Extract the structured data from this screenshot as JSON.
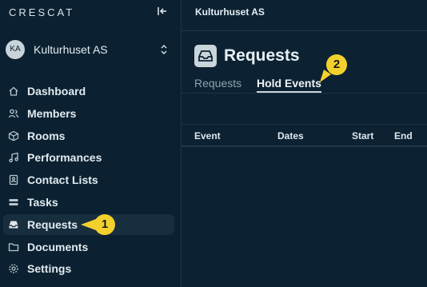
{
  "sidebar": {
    "logo": "CRESCAT",
    "org": {
      "initials": "KA",
      "name": "Kulturhuset AS"
    },
    "items": [
      {
        "label": "Dashboard",
        "icon": "home-icon"
      },
      {
        "label": "Members",
        "icon": "users-icon"
      },
      {
        "label": "Rooms",
        "icon": "cube-icon"
      },
      {
        "label": "Performances",
        "icon": "music-icon"
      },
      {
        "label": "Contact Lists",
        "icon": "contact-card-icon"
      },
      {
        "label": "Tasks",
        "icon": "tasks-icon"
      },
      {
        "label": "Requests",
        "icon": "inbox-icon",
        "active": true
      },
      {
        "label": "Documents",
        "icon": "folder-icon"
      },
      {
        "label": "Settings",
        "icon": "gear-icon"
      }
    ]
  },
  "topbar": {
    "title": "Kulturhuset AS"
  },
  "page": {
    "title": "Requests",
    "tabs": [
      {
        "label": "Requests",
        "active": false
      },
      {
        "label": "Hold Events",
        "active": true
      }
    ]
  },
  "table": {
    "columns": [
      "Event",
      "Dates",
      "Start",
      "End"
    ]
  },
  "annotations": {
    "step1": "1",
    "step2": "2"
  },
  "colors": {
    "background": "#0c2232",
    "callout": "#f4d02d",
    "active_item": "#172e3f"
  }
}
